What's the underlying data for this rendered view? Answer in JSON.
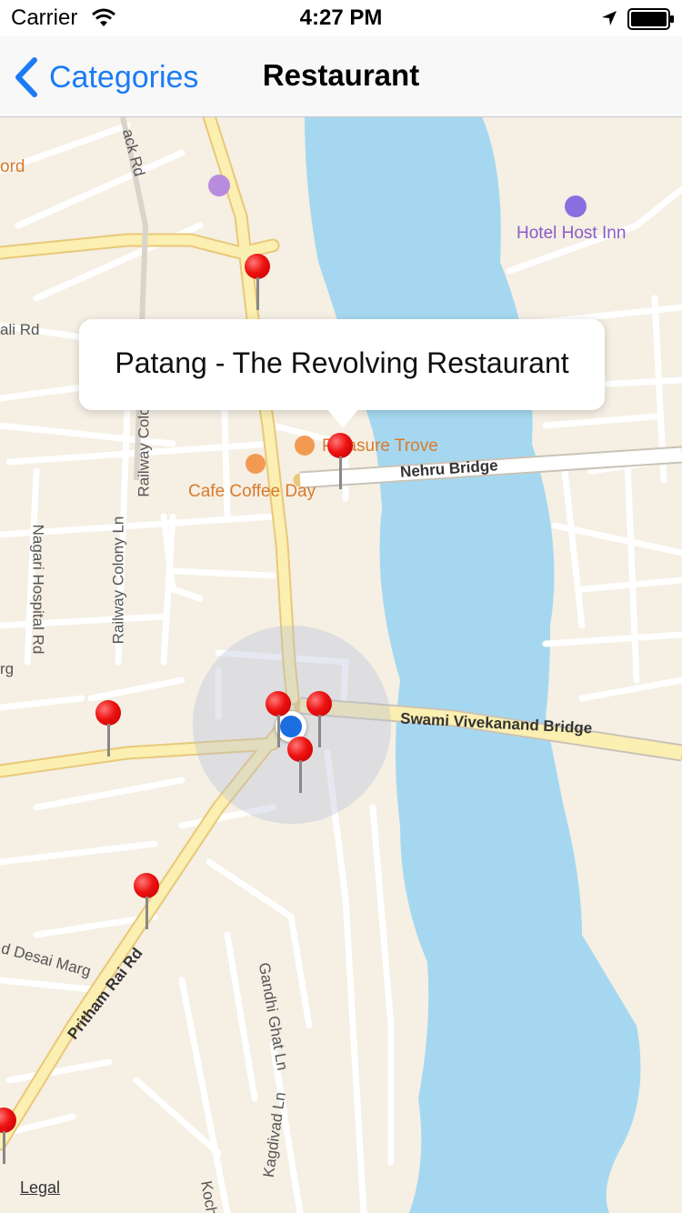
{
  "status_bar": {
    "carrier": "Carrier",
    "time": "4:27 PM"
  },
  "nav": {
    "back_label": "Categories",
    "title": "Restaurant"
  },
  "callout": {
    "text": "Patang - The Revolving Restaurant"
  },
  "map": {
    "legal": "Legal",
    "labels": {
      "hotel": "Hotel Host Inn",
      "treasure": "Pleasure Trove",
      "cafe": "Cafe Coffee Day",
      "nehru_bridge": "Nehru Bridge",
      "swami_bridge": "Swami Vivekanand Bridge",
      "railway_colony_ln": "Railway Colony Ln",
      "railway_colony": "Railway Colony",
      "nagari_hospital": "Nagari Hospital Rd",
      "pritham_rai": "Pritham Rai Rd",
      "gandhi_ghat": "Gandhi Ghat Ln",
      "kagdivad": "Kagdivad Ln",
      "desai_marg": "d Desai Marg",
      "rd_fragment": "ack Rd",
      "ali_rd": "ali Rd",
      "ord": "ord",
      "rg": "rg",
      "koch": "Koch"
    },
    "colors": {
      "water": "#a5d8f0",
      "land": "#f5efe4",
      "major_road": "#fbefb1",
      "pin": "#ee1111",
      "user_dot": "#1b6de0"
    }
  }
}
